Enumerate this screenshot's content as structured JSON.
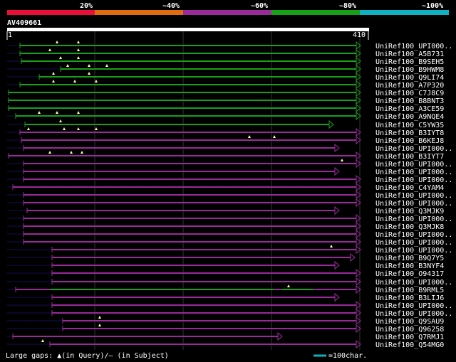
{
  "scale_labels": [
    "20%",
    "~40%",
    "~60%",
    "~80%",
    "~100%"
  ],
  "scale_colors": [
    "#e8103a",
    "#e06c12",
    "#9a2a9a",
    "#18a018",
    "#10b0c0"
  ],
  "query": {
    "name": "AV409661",
    "start": "1",
    "end": "410",
    "length": 410
  },
  "legend": {
    "text": "Large gaps: ▲(in Query)/– (in Subject)",
    "scale_text": "=100char."
  },
  "hits": [
    {
      "label": "UniRef100_UPI000..",
      "color": "green",
      "start": 28,
      "end": 500,
      "arrow": true,
      "marks": [
        80,
        110
      ]
    },
    {
      "label": "UniRef100_A5B731",
      "color": "green",
      "start": 28,
      "end": 500,
      "arrow": true,
      "marks": [
        70,
        110
      ]
    },
    {
      "label": "UniRef100_B9SEH5",
      "color": "green",
      "start": 30,
      "end": 500,
      "arrow": true,
      "marks": [
        85,
        110
      ]
    },
    {
      "label": "UniRef100_B9HWM8",
      "color": "green",
      "start": 85,
      "end": 500,
      "arrow": true,
      "marks": [
        95,
        125,
        150
      ]
    },
    {
      "label": "UniRef100_Q9LI74",
      "color": "green",
      "start": 55,
      "end": 500,
      "arrow": true,
      "marks": [
        75,
        125
      ]
    },
    {
      "label": "UniRef100_A7P320",
      "color": "green",
      "start": 28,
      "end": 500,
      "arrow": true,
      "marks": [
        75,
        105,
        135
      ]
    },
    {
      "label": "UniRef100_C7J8C9",
      "color": "green",
      "start": 12,
      "end": 500,
      "arrow": true,
      "marks": []
    },
    {
      "label": "UniRef100_B8BNT3",
      "color": "green",
      "start": 12,
      "end": 500,
      "arrow": true,
      "marks": []
    },
    {
      "label": "UniRef100_A3CE59",
      "color": "green",
      "start": 12,
      "end": 500,
      "arrow": true,
      "marks": []
    },
    {
      "label": "UniRef100_A9NQE4",
      "color": "green",
      "start": 22,
      "end": 500,
      "arrow": true,
      "marks": [
        55,
        80,
        110
      ]
    },
    {
      "label": "UniRef100_C5YW35",
      "color": "green",
      "start": 35,
      "end": 462,
      "arrow": true,
      "marks": [
        85
      ]
    },
    {
      "label": "UniRef100_B3IYT8",
      "color": "purple",
      "start": 28,
      "end": 500,
      "arrow": true,
      "marks": [
        40,
        90,
        110,
        135
      ]
    },
    {
      "label": "UniRef100_B6KEJ8",
      "color": "purple",
      "start": 30,
      "end": 500,
      "arrow": true,
      "marks": [
        350,
        385
      ]
    },
    {
      "label": "UniRef100_UPI000..",
      "color": "purple",
      "start": 33,
      "end": 470,
      "arrow": true,
      "marks": []
    },
    {
      "label": "UniRef100_B3IYT7",
      "color": "purple",
      "start": 12,
      "end": 500,
      "arrow": true,
      "marks": [
        70,
        100,
        115
      ]
    },
    {
      "label": "UniRef100_UPI000..",
      "color": "purple",
      "start": 33,
      "end": 500,
      "arrow": true,
      "marks": [
        480
      ]
    },
    {
      "label": "UniRef100_UPI000..",
      "color": "purple",
      "start": 33,
      "end": 470,
      "arrow": true,
      "marks": []
    },
    {
      "label": "UniRef100_UPI000..",
      "color": "purple",
      "start": 33,
      "end": 500,
      "arrow": true,
      "marks": []
    },
    {
      "label": "UniRef100_C4YAM4",
      "color": "purple",
      "start": 18,
      "end": 500,
      "arrow": true,
      "marks": []
    },
    {
      "label": "UniRef100_UPI000..",
      "color": "purple",
      "start": 33,
      "end": 500,
      "arrow": true,
      "marks": []
    },
    {
      "label": "UniRef100_UPI000..",
      "color": "purple",
      "start": 33,
      "end": 500,
      "arrow": true,
      "marks": []
    },
    {
      "label": "UniRef100_Q3MJK9",
      "color": "purple",
      "start": 38,
      "end": 470,
      "arrow": true,
      "marks": []
    },
    {
      "label": "UniRef100_UPI000..",
      "color": "purple",
      "start": 33,
      "end": 500,
      "arrow": true,
      "marks": []
    },
    {
      "label": "UniRef100_Q3MJK8",
      "color": "purple",
      "start": 33,
      "end": 500,
      "arrow": true,
      "marks": []
    },
    {
      "label": "UniRef100_UPI000..",
      "color": "purple",
      "start": 33,
      "end": 500,
      "arrow": true,
      "marks": []
    },
    {
      "label": "UniRef100_UPI000..",
      "color": "purple",
      "start": 33,
      "end": 500,
      "arrow": true,
      "marks": []
    },
    {
      "label": "UniRef100_UPI000..",
      "color": "purple",
      "start": 73,
      "end": 500,
      "arrow": true,
      "marks": [
        465
      ]
    },
    {
      "label": "UniRef100_B9Q7Y5",
      "color": "purple",
      "start": 73,
      "end": 492,
      "arrow": true,
      "marks": []
    },
    {
      "label": "UniRef100_B3NYF4",
      "color": "purple",
      "start": 73,
      "end": 470,
      "arrow": true,
      "marks": []
    },
    {
      "label": "UniRef100_O94317",
      "color": "purple",
      "start": 73,
      "end": 500,
      "arrow": true,
      "marks": []
    },
    {
      "label": "UniRef100_UPI000..",
      "color": "purple",
      "start": 73,
      "end": 500,
      "arrow": true,
      "marks": []
    },
    {
      "label": "UniRef100_B9RML5",
      "color": "mixed",
      "start": 22,
      "end": 500,
      "arrow": true,
      "marks": [
        405
      ]
    },
    {
      "label": "UniRef100_B3LIJ6",
      "color": "purple",
      "start": 73,
      "end": 470,
      "arrow": true,
      "marks": []
    },
    {
      "label": "UniRef100_UPI000..",
      "color": "purple",
      "start": 73,
      "end": 500,
      "arrow": true,
      "marks": []
    },
    {
      "label": "UniRef100_UPI000..",
      "color": "purple",
      "start": 73,
      "end": 500,
      "arrow": true,
      "marks": []
    },
    {
      "label": "UniRef100_Q9SAU9",
      "color": "purple",
      "start": 88,
      "end": 500,
      "arrow": true,
      "marks": [
        140
      ]
    },
    {
      "label": "UniRef100_Q96258",
      "color": "purple",
      "start": 88,
      "end": 500,
      "arrow": true,
      "marks": [
        140
      ]
    },
    {
      "label": "UniRef100_Q7RMJ1",
      "color": "purple",
      "start": 18,
      "end": 390,
      "arrow": true,
      "marks": []
    },
    {
      "label": "UniRef100_Q54MG0",
      "color": "purple",
      "start": 70,
      "end": 500,
      "arrow": true,
      "marks": [
        60
      ]
    }
  ]
}
